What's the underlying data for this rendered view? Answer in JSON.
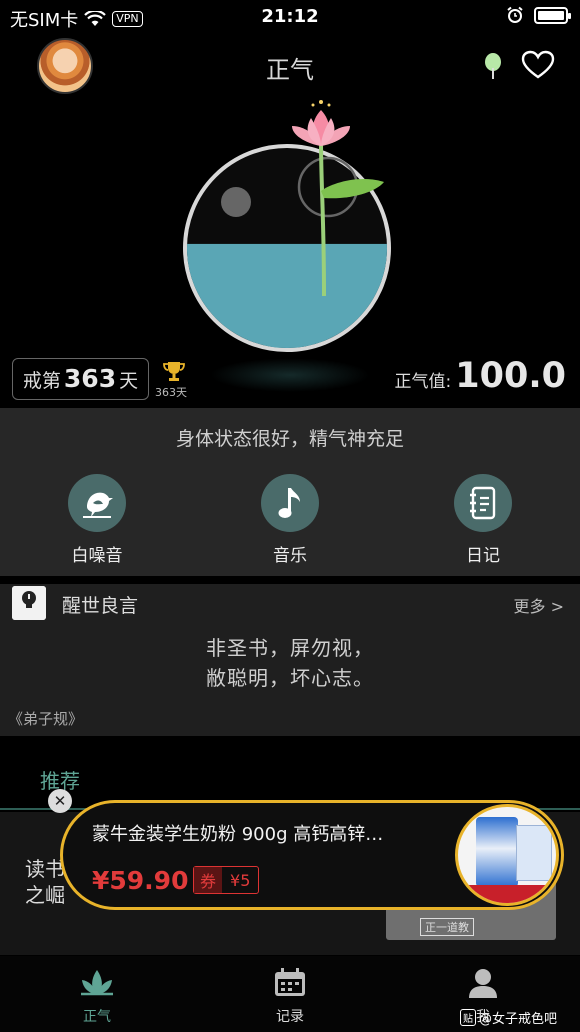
{
  "status_bar": {
    "carrier": "无SIM卡",
    "vpn": "VPN",
    "time": "21:12"
  },
  "header": {
    "title": "正气"
  },
  "stats": {
    "days_prefix": "戒第",
    "days_value": "363",
    "days_suffix": "天",
    "trophy_label": "363天",
    "energy_label": "正气值:",
    "energy_value": "100.0",
    "water_level": 0.52
  },
  "status_text": "身体状态很好，精气神充足",
  "tools": [
    {
      "label": "白噪音",
      "icon": "bird-icon"
    },
    {
      "label": "音乐",
      "icon": "music-note-icon"
    },
    {
      "label": "日记",
      "icon": "notebook-icon"
    }
  ],
  "quote": {
    "section_title": "醒世良言",
    "more": "更多 >",
    "line1": "非圣书，屏勿视，",
    "line2": "敝聪明，坏心志。",
    "source": "《弟子规》"
  },
  "recommend": {
    "tab": "推荐",
    "text_line1": "读书",
    "text_line2": "之崛起",
    "thumb_label": "正一道教"
  },
  "ad": {
    "title": "蒙牛金装学生奶粉 900g 高钙高锌…",
    "price": "¥59.90",
    "coupon_tag": "券",
    "coupon_amount": "¥5",
    "close": "✕"
  },
  "nav": [
    {
      "label": "正气",
      "icon": "lotus-icon",
      "active": true
    },
    {
      "label": "记录",
      "icon": "calendar-icon",
      "active": false
    },
    {
      "label": "我",
      "icon": "profile-icon",
      "active": false
    }
  ],
  "watermark": {
    "badge": "贴",
    "text": "@女子戒色吧"
  },
  "colors": {
    "accent": "#5fa595",
    "water": "#5aa6b5",
    "ad_border": "#e8b32a",
    "price": "#e23b3b",
    "panel": "#272727"
  }
}
